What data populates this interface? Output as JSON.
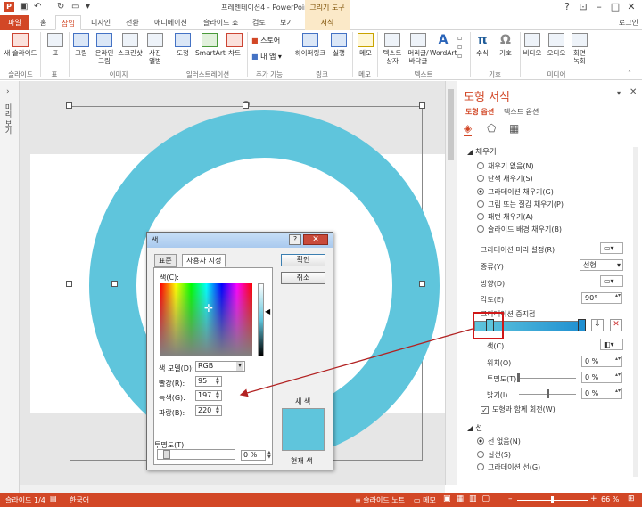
{
  "window": {
    "title": "프레젠테이션4 - PowerPoint",
    "contextual_tab_group": "그리기 도구",
    "login": "로그인"
  },
  "tabs": [
    "파일",
    "홈",
    "삽입",
    "디자인",
    "전환",
    "애니메이션",
    "슬라이드 쇼",
    "검토",
    "보기",
    "서식"
  ],
  "ribbon": {
    "buttons": [
      {
        "label": "새 슬라이드",
        "icon": "new-slide-icon"
      },
      {
        "label": "표",
        "icon": "table-icon"
      },
      {
        "label": "그림",
        "icon": "picture-icon"
      },
      {
        "label": "온라인\n그림",
        "icon": "online-picture-icon"
      },
      {
        "label": "스크린샷",
        "icon": "screenshot-icon"
      },
      {
        "label": "사진\n앨범",
        "icon": "photo-album-icon"
      },
      {
        "label": "도형",
        "icon": "shapes-icon"
      },
      {
        "label": "SmartArt",
        "icon": "smartart-icon"
      },
      {
        "label": "차트",
        "icon": "chart-icon"
      },
      {
        "label": "스토어",
        "icon": "store-icon"
      },
      {
        "label": "내 앱",
        "icon": "my-apps-icon"
      },
      {
        "label": "하이퍼링크",
        "icon": "hyperlink-icon"
      },
      {
        "label": "실행",
        "icon": "action-icon"
      },
      {
        "label": "메모",
        "icon": "comment-icon"
      },
      {
        "label": "텍스트\n상자",
        "icon": "textbox-icon"
      },
      {
        "label": "머리글/\n바닥글",
        "icon": "header-footer-icon"
      },
      {
        "label": "WordArt",
        "icon": "wordart-icon"
      },
      {
        "label": "수식",
        "icon": "equation-icon"
      },
      {
        "label": "기호",
        "icon": "symbol-icon"
      },
      {
        "label": "비디오",
        "icon": "video-icon"
      },
      {
        "label": "오디오",
        "icon": "audio-icon"
      },
      {
        "label": "화면\n녹화",
        "icon": "screen-recording-icon"
      }
    ],
    "groups": [
      "슬라이드",
      "표",
      "이미지",
      "일러스트레이션",
      "추가 기능",
      "링크",
      "메모",
      "텍스트",
      "기호",
      "미디어"
    ]
  },
  "left_pane": {
    "label": "미리 보기"
  },
  "format_pane": {
    "title": "도형 서식",
    "tab_shape_options": "도형 옵션",
    "tab_text_options": "텍스트 옵션",
    "fill_section": "채우기",
    "fill_options": [
      {
        "label": "채우기 없음(N)",
        "selected": false
      },
      {
        "label": "단색 채우기(S)",
        "selected": false
      },
      {
        "label": "그라데이션 채우기(G)",
        "selected": true
      },
      {
        "label": "그림 또는 질감 채우기(P)",
        "selected": false
      },
      {
        "label": "패턴 채우기(A)",
        "selected": false
      },
      {
        "label": "슬라이드 배경 채우기(B)",
        "selected": false
      }
    ],
    "preset_gradient_label": "그라데이션 미리 설정(R)",
    "type_label": "종류(Y)",
    "type_value": "선형",
    "direction_label": "방향(D)",
    "angle_label": "각도(E)",
    "angle_value": "90°",
    "stops_label": "그라데이션 중지점",
    "color_label": "색(C)",
    "position_label": "위치(O)",
    "position_value": "0 %",
    "transparency_label": "투명도(T)",
    "transparency_value": "0 %",
    "brightness_label": "밝기(I)",
    "brightness_value": "0 %",
    "rotate_with_shape": "도형과 함께 회전(W)",
    "line_section": "선",
    "line_options": [
      {
        "label": "선 없음(N)",
        "selected": true
      },
      {
        "label": "실선(S)",
        "selected": false
      },
      {
        "label": "그라데이션 선(G)",
        "selected": false
      }
    ],
    "gradient_colors": {
      "start": "#5fc5dc",
      "end": "#1f8fd1"
    }
  },
  "color_dialog": {
    "title": "색",
    "tab_standard": "표준",
    "tab_custom": "사용자 지정",
    "ok": "확인",
    "cancel": "취소",
    "colors_label": "색(C):",
    "color_model_label": "색 모델(D):",
    "color_model_value": "RGB",
    "red_label": "빨강(R):",
    "red_value": "95",
    "green_label": "녹색(G):",
    "green_value": "197",
    "blue_label": "파랑(B):",
    "blue_value": "220",
    "transparency_label": "투명도(T):",
    "transparency_value": "0 %",
    "new_label": "새 색",
    "current_label": "현재 색",
    "selected_color": "#5fc5dc"
  },
  "status_bar": {
    "slide": "슬라이드 1/4",
    "language": "한국어",
    "notes": "슬라이드 노트",
    "comments": "메모",
    "zoom": "66 %"
  },
  "colors": {
    "accent": "#d24726",
    "shape": "#5fc5dc"
  }
}
